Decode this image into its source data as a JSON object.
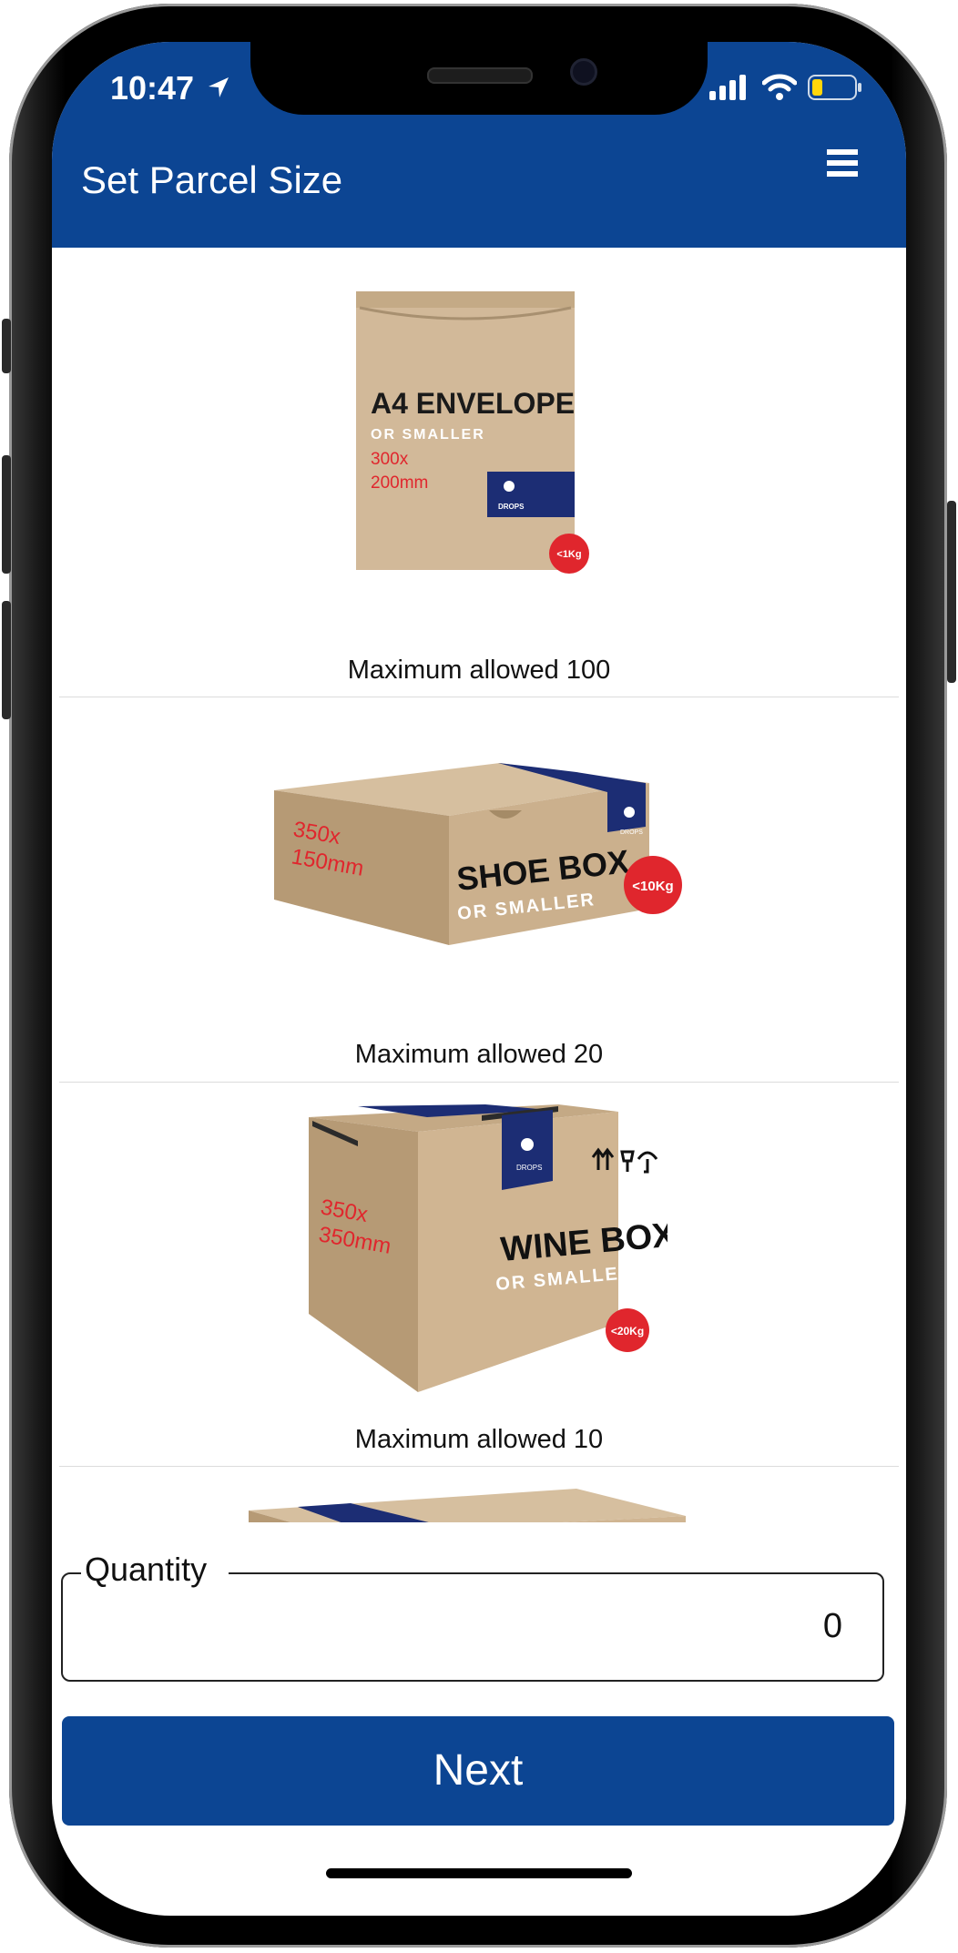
{
  "status_bar": {
    "time": "10:47"
  },
  "header": {
    "title": "Set Parcel Size",
    "menu_icon": "hamburger-menu-icon"
  },
  "colors": {
    "brand_blue": "#0c4593",
    "badge_red": "#e0262d",
    "cardboard": "#d2b999"
  },
  "parcels": [
    {
      "name_line1": "A4 ENVELOPE",
      "name_line2": "OR SMALLER",
      "dims_line1": "300x",
      "dims_line2": "200mm",
      "weight": "<1Kg",
      "brand": "DROPS",
      "caption": "Maximum allowed 100"
    },
    {
      "name_line1": "SHOE BOX",
      "name_line2": "OR SMALLER",
      "dims_line1": "350x",
      "dims_line2": "150mm",
      "weight": "<10Kg",
      "brand": "DROPS",
      "caption": "Maximum allowed 20"
    },
    {
      "name_line1": "WINE BOX",
      "name_line2": "OR SMALLER",
      "dims_line1": "350x",
      "dims_line2": "350mm",
      "weight": "<20Kg",
      "brand": "DROPS",
      "caption": "Maximum allowed 10"
    }
  ],
  "quantity": {
    "label": "Quantity",
    "value": "0"
  },
  "next_button": {
    "label": "Next"
  }
}
